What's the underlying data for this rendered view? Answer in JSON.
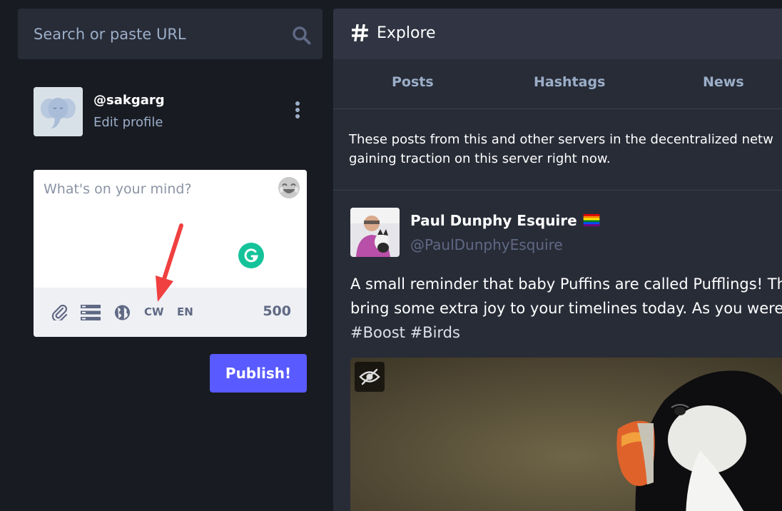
{
  "search": {
    "placeholder": "Search or paste URL",
    "icon": "search-icon"
  },
  "account": {
    "handle": "@sakgarg",
    "edit_label": "Edit profile"
  },
  "composer": {
    "placeholder": "What's on your mind?",
    "tools": {
      "cw": "CW",
      "language": "EN"
    },
    "char_count": "500",
    "publish_label": "Publish!"
  },
  "column": {
    "title": "Explore",
    "tabs": [
      "Posts",
      "Hashtags",
      "News"
    ],
    "intro_lines": [
      "These posts from this and other servers in the decentralized netw",
      "gaining traction on this server right now."
    ]
  },
  "post": {
    "display_name": "Paul Dunphy Esquire",
    "handle": "@PaulDunphyEsquire",
    "lines": [
      "A small reminder that baby Puffins are called Pufflings! This t",
      "bring some extra joy to your timelines today. As you were."
    ],
    "hashtags": [
      "#Boost",
      "#Birds"
    ]
  },
  "colors": {
    "accent": "#595aff",
    "bg": "#191b22",
    "panel": "#282c37",
    "muted": "#9baec8",
    "grammarly": "#15c39a",
    "annotation_arrow": "#f04040"
  }
}
